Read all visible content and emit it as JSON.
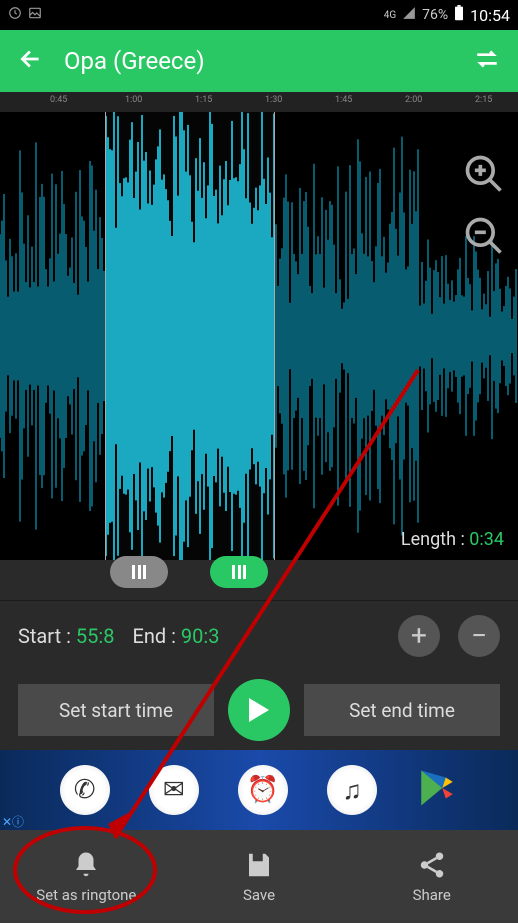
{
  "status": {
    "network": "4G",
    "battery": "76%",
    "time": "10:54"
  },
  "header": {
    "title": "Opa (Greece)"
  },
  "timeline": {
    "ticks": [
      "0:45",
      "1:00",
      "1:15",
      "1:30",
      "1:45",
      "2:00",
      "2:15"
    ],
    "length_label": "Length : ",
    "length_value": "0:34"
  },
  "editor": {
    "start_label": "Start : ",
    "start_value": "55:8",
    "end_label": "End : ",
    "end_value": "90:3",
    "set_start": "Set start time",
    "set_end": "Set end time"
  },
  "nav": {
    "ringtone": "Set as ringtone",
    "save": "Save",
    "share": "Share"
  },
  "colors": {
    "accent": "#2ac865",
    "wave": "#00c8e8"
  }
}
